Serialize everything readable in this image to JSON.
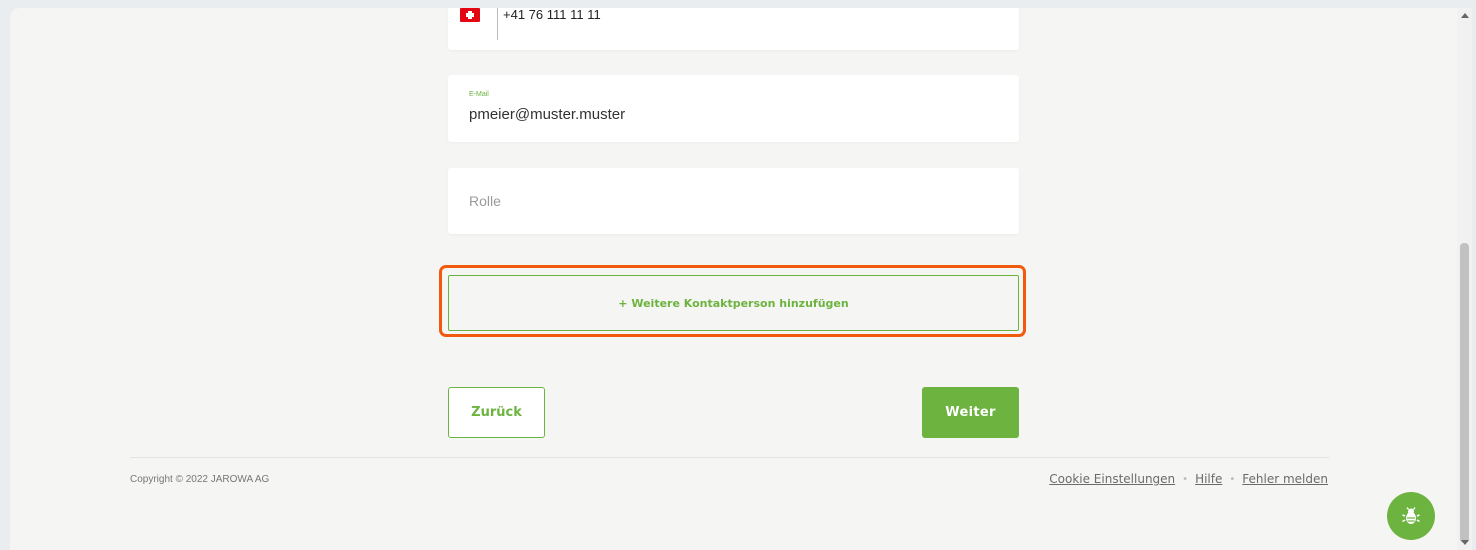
{
  "form": {
    "phone": {
      "country_flag": "switzerland-flag-icon",
      "value": "+41 76 111 11 11"
    },
    "email": {
      "label": "E-Mail",
      "value": "pmeier@muster.muster"
    },
    "role": {
      "placeholder": "Rolle"
    },
    "add_contact_label": "+ Weitere Kontaktperson hinzufügen"
  },
  "navigation": {
    "back_label": "Zurück",
    "next_label": "Weiter"
  },
  "footer": {
    "copyright": "Copyright © 2022 JAROWA AG",
    "links": [
      "Cookie Einstellungen",
      "Hilfe",
      "Fehler melden"
    ],
    "separator": "•"
  },
  "colors": {
    "accent": "#6cb33f",
    "highlight": "#f15a0c"
  },
  "icons": {
    "bug_report": "bug-icon"
  }
}
